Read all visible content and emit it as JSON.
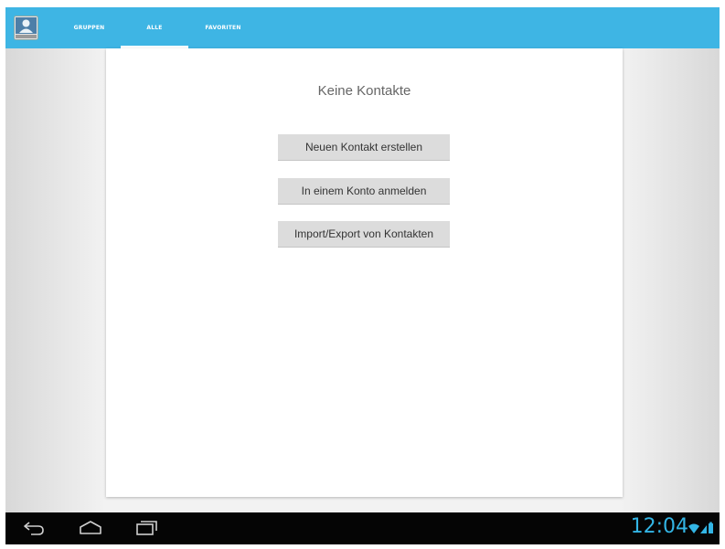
{
  "tabs": [
    {
      "label": "GRUPPEN",
      "selected": false
    },
    {
      "label": "ALLE",
      "selected": true
    },
    {
      "label": "FAVORITEN",
      "selected": false
    }
  ],
  "main": {
    "empty_title": "Keine Kontakte",
    "buttons": {
      "new_contact": "Neuen Kontakt erstellen",
      "sign_in": "In einem Konto anmelden",
      "import_export": "Import/Export von Kontakten"
    }
  },
  "nav": {
    "back_icon": "back-icon",
    "home_icon": "home-icon",
    "recents_icon": "recents-icon"
  },
  "status": {
    "time": "12:04",
    "icons": [
      "wifi-icon",
      "signal-icon",
      "battery-icon"
    ]
  },
  "colors": {
    "action_bar": "#3eb5e4",
    "clock": "#33b5e5",
    "nav_bar": "#050505"
  }
}
